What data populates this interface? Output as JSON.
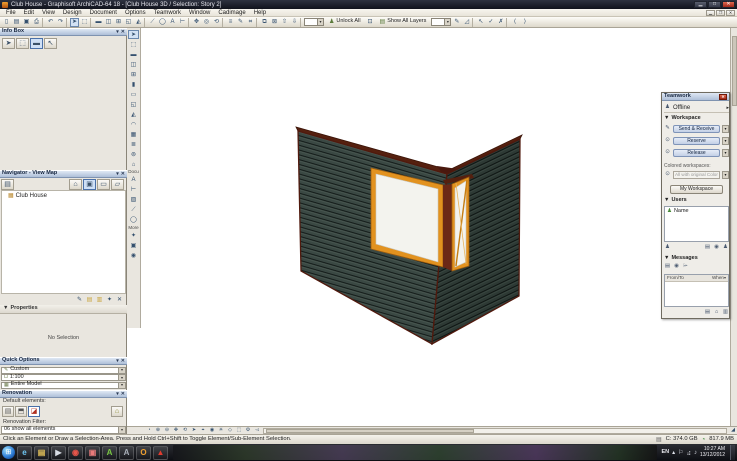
{
  "titlebar": {
    "title": "Club House - Graphisoft ArchiCAD-64 18 - [Club House 3D / Selection: Story 2]"
  },
  "menubar": {
    "items": [
      "File",
      "Edit",
      "View",
      "Design",
      "Document",
      "Options",
      "Teamwork",
      "Window",
      "Cadimage",
      "Help"
    ]
  },
  "toolbar": {
    "left_icons": [
      {
        "n": "new-icon",
        "g": "▯"
      },
      {
        "n": "open-icon",
        "g": "▤"
      },
      {
        "n": "save-icon",
        "g": "▣"
      },
      {
        "n": "print-icon",
        "g": "⎙"
      },
      {
        "n": "separator"
      },
      {
        "n": "undo-icon",
        "g": "↶"
      },
      {
        "n": "redo-icon",
        "g": "↷"
      },
      {
        "n": "separator"
      },
      {
        "n": "arrow-tool-icon",
        "g": "➤",
        "sel": true
      },
      {
        "n": "marquee-tool-icon",
        "g": "⬚"
      },
      {
        "n": "separator"
      },
      {
        "n": "wall-icon",
        "g": "▬"
      },
      {
        "n": "door-icon",
        "g": "◫"
      },
      {
        "n": "window-icon",
        "g": "⊞"
      },
      {
        "n": "slab-icon",
        "g": "◱"
      },
      {
        "n": "roof-icon",
        "g": "◭"
      },
      {
        "n": "separator"
      },
      {
        "n": "line-icon",
        "g": "⟋"
      },
      {
        "n": "circle-icon",
        "g": "◯"
      },
      {
        "n": "text-icon",
        "g": "A"
      },
      {
        "n": "dimension-icon",
        "g": "⊢"
      },
      {
        "n": "separator"
      },
      {
        "n": "pan-icon",
        "g": "✥"
      },
      {
        "n": "zoom-icon",
        "g": "◎"
      },
      {
        "n": "orbit-icon",
        "g": "⟲"
      },
      {
        "n": "separator"
      },
      {
        "n": "layers-icon",
        "g": "≡"
      },
      {
        "n": "pens-icon",
        "g": "✎"
      },
      {
        "n": "grid-icon",
        "g": "⌗"
      },
      {
        "n": "separator"
      },
      {
        "n": "group-icon",
        "g": "⧉"
      },
      {
        "n": "lock-icon",
        "g": "⊠"
      },
      {
        "n": "bring-forward-icon",
        "g": "⇧"
      },
      {
        "n": "send-back-icon",
        "g": "⇩"
      },
      {
        "n": "separator"
      }
    ],
    "unlock_all": "Unlock All",
    "show_all_layers": "Show All Layers",
    "right_icons": [
      {
        "n": "pen-icon",
        "g": "✎"
      },
      {
        "n": "eraser-icon",
        "g": "◿"
      },
      {
        "n": "separator"
      },
      {
        "n": "pick-icon",
        "g": "↖"
      },
      {
        "n": "check-icon",
        "g": "✓"
      },
      {
        "n": "cancel-icon",
        "g": "✗"
      },
      {
        "n": "separator"
      },
      {
        "n": "prev-icon",
        "g": "⟨"
      },
      {
        "n": "next-icon",
        "g": "⟩"
      }
    ]
  },
  "toolbox": {
    "select_icons": [
      {
        "n": "toolbox-arrow-icon",
        "g": "➤",
        "sel": true
      },
      {
        "n": "toolbox-marquee-icon",
        "g": "⬚"
      }
    ],
    "design_icons": [
      {
        "n": "toolbox-wall-icon",
        "g": "▬"
      },
      {
        "n": "toolbox-door-icon",
        "g": "◫"
      },
      {
        "n": "toolbox-window-icon",
        "g": "⊞"
      },
      {
        "n": "toolbox-column-icon",
        "g": "▮"
      },
      {
        "n": "toolbox-beam-icon",
        "g": "▭"
      },
      {
        "n": "toolbox-slab-icon",
        "g": "◱"
      },
      {
        "n": "toolbox-roof-icon",
        "g": "◭"
      },
      {
        "n": "toolbox-shell-icon",
        "g": "◠"
      },
      {
        "n": "toolbox-mesh-icon",
        "g": "▦"
      },
      {
        "n": "toolbox-stair-icon",
        "g": "≣"
      },
      {
        "n": "toolbox-object-icon",
        "g": "⊚"
      },
      {
        "n": "toolbox-zone-icon",
        "g": "⌂"
      }
    ],
    "document_label": "Docu",
    "document_icons": [
      {
        "n": "toolbox-text-icon",
        "g": "A"
      },
      {
        "n": "toolbox-dimension-icon",
        "g": "⊢"
      },
      {
        "n": "toolbox-fill-icon",
        "g": "▨"
      },
      {
        "n": "toolbox-line-icon",
        "g": "⟋"
      },
      {
        "n": "toolbox-circle-icon",
        "g": "◯"
      }
    ],
    "more_label": "More",
    "more_icons": [
      {
        "n": "toolbox-hotspot-icon",
        "g": "✦"
      },
      {
        "n": "toolbox-figure-icon",
        "g": "▣"
      },
      {
        "n": "toolbox-camera-icon",
        "g": "◉"
      }
    ]
  },
  "info_box": {
    "title": "Info Box",
    "tools": [
      {
        "n": "infobox-arrow-icon",
        "g": "➤"
      },
      {
        "n": "infobox-marquee-icon",
        "g": "⬚"
      },
      {
        "n": "infobox-wall-icon",
        "g": "▬",
        "sel": true
      },
      {
        "n": "infobox-cursor-icon",
        "g": "↖"
      }
    ]
  },
  "navigator": {
    "title": "Navigator - View Map",
    "left_tools": [
      {
        "n": "project-chooser-icon",
        "g": "▤"
      }
    ],
    "right_tools": [
      {
        "n": "home-icon",
        "g": "⌂"
      },
      {
        "n": "viewmap-icon",
        "g": "▣",
        "sel": true
      },
      {
        "n": "layoutbook-icon",
        "g": "▭"
      },
      {
        "n": "publisher-icon",
        "g": "▱"
      }
    ],
    "items": [
      {
        "label": "Club House"
      }
    ]
  },
  "properties": {
    "tools": [
      {
        "n": "prop-settings-icon",
        "g": "✎"
      },
      {
        "n": "prop-folder-icon",
        "g": "▤",
        "c": "#c8a43c"
      },
      {
        "n": "prop-folder2-icon",
        "g": "▥",
        "c": "#c8a43c"
      },
      {
        "n": "prop-pin-icon",
        "g": "✦"
      },
      {
        "n": "prop-close-icon",
        "g": "✕"
      }
    ],
    "title": "Properties",
    "empty": "No Selection"
  },
  "quick_options": {
    "title": "Quick Options",
    "rows": [
      "Custom",
      "1:100",
      "Entire Model"
    ]
  },
  "renovation": {
    "title": "Renovation",
    "default_label": "Default elements:",
    "toggles": [
      {
        "n": "existing-elements-icon",
        "g": "▤"
      },
      {
        "n": "demolished-elements-icon",
        "g": "⬒"
      },
      {
        "n": "new-elements-icon",
        "g": "◪",
        "c": "#b03020",
        "sel": true
      }
    ],
    "right_tools": [
      {
        "n": "renovation-options-icon",
        "g": "⌂",
        "c": "#8a8a30"
      }
    ],
    "filter_label": "Renovation Filter:",
    "filter_value": "06 show all elements"
  },
  "teamwork": {
    "title": "Teamwork",
    "status": "Offline",
    "workspace_label": "Workspace",
    "send_receive": "Send & Receive",
    "reserve": "Reserve",
    "release": "Release",
    "colored_label": "Colored workspaces:",
    "colored_value": "All with original Color",
    "my_workspace": "My Workspace",
    "users_label": "Users",
    "user_name": "Name",
    "users_tools_left": [
      {
        "n": "add-user-icon",
        "g": "♟"
      }
    ],
    "users_tools_right": [
      {
        "n": "mail-user-icon",
        "g": "▤"
      },
      {
        "n": "user-settings-icon",
        "g": "◉"
      },
      {
        "n": "user-list-icon",
        "g": "♟"
      }
    ],
    "messages_label": "Messages",
    "message_tools": [
      {
        "n": "new-message-icon",
        "g": "▤"
      },
      {
        "n": "voice-message-icon",
        "g": "◉"
      },
      {
        "n": "send-message-icon",
        "g": "⌲"
      }
    ],
    "col_from": "From/To",
    "col_when": "When",
    "bottom_tools": [
      {
        "n": "msg-archive-icon",
        "g": "▤"
      },
      {
        "n": "msg-home-icon",
        "g": "⌂"
      },
      {
        "n": "msg-panel-icon",
        "g": "▥"
      }
    ]
  },
  "canvas_toolbar": {
    "icons": [
      {
        "n": "fit-in-window-icon",
        "g": "◔"
      },
      {
        "n": "zoom-in-icon",
        "g": "⊕"
      },
      {
        "n": "zoom-out-icon",
        "g": "⊖"
      },
      {
        "n": "pan-hand-icon",
        "g": "✥"
      },
      {
        "n": "orbit-3d-icon",
        "g": "⟲"
      },
      {
        "n": "explore-icon",
        "g": "➤"
      },
      {
        "n": "look-to-icon",
        "g": "⌖"
      },
      {
        "n": "camera-icon",
        "g": "◉"
      },
      {
        "n": "sun-icon",
        "g": "☀"
      },
      {
        "n": "perspective-icon",
        "g": "◇"
      },
      {
        "n": "axono-icon",
        "g": "⬚"
      },
      {
        "n": "settings-3d-icon",
        "g": "⚙"
      },
      {
        "n": "previous-view-icon",
        "g": "◅"
      }
    ]
  },
  "statusbar": {
    "hint": "Click an Element or Draw a Selection-Area. Press and Hold Ctrl+Shift to Toggle Element/Sub-Element Selection.",
    "disk": "C: 374.0 GB",
    "memory": "817.9 MB"
  },
  "taskbar": {
    "apps": [
      {
        "n": "internet-explorer-icon",
        "g": "e",
        "c": "#6ec6f2"
      },
      {
        "n": "explorer-folder-icon",
        "g": "▤",
        "c": "#e8c55a"
      },
      {
        "n": "media-player-icon",
        "g": "▶",
        "c": "#d8dce4"
      },
      {
        "n": "chrome-icon",
        "g": "◉",
        "c": "#e8554a"
      },
      {
        "n": "photo-app-icon",
        "g": "▣",
        "c": "#e87a7a"
      },
      {
        "n": "archicad-icon",
        "g": "A",
        "c": "#7ac943"
      },
      {
        "n": "archicad-alt-icon",
        "g": "A",
        "c": "#aab0ba"
      },
      {
        "n": "outlook-icon",
        "g": "O",
        "c": "#f0a030"
      },
      {
        "n": "adobe-reader-icon",
        "g": "▲",
        "c": "#e23b2e"
      }
    ],
    "tray": [
      {
        "n": "hidden-icons-icon",
        "g": "▴"
      },
      {
        "n": "flag-icon",
        "g": "⚐"
      },
      {
        "n": "network-icon",
        "g": "⣴"
      },
      {
        "n": "volume-icon",
        "g": "♪"
      }
    ],
    "language": "EN",
    "time": "10:27 AM",
    "date": "13/12/2012"
  },
  "model": {
    "description": "Two walls meeting at a corner with dark horizontal siding and an orange-framed corner window, one sash open",
    "colors": {
      "siding_dark": "#18211f",
      "siding_light": "#41504a",
      "edge": "#55200f",
      "frame": "#e2921f",
      "glass": "#f3f3ee",
      "background": "#ffffff"
    }
  }
}
